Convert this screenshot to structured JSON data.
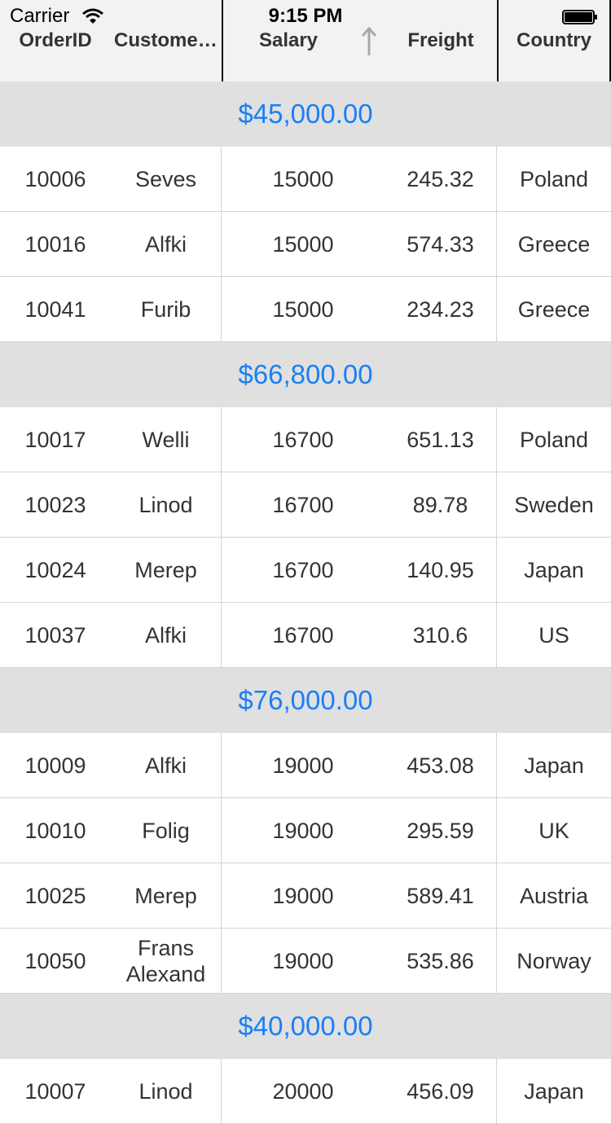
{
  "status_bar": {
    "carrier": "Carrier",
    "time": "9:15 PM"
  },
  "columns": [
    {
      "label": "OrderID"
    },
    {
      "label": "Customer..."
    },
    {
      "label": "Salary",
      "sort": "ascending"
    },
    {
      "label": "Freight"
    },
    {
      "label": "Country"
    }
  ],
  "groups": [
    {
      "caption": "$45,000.00",
      "rows": [
        [
          "10006",
          "Seves",
          "15000",
          "245.32",
          "Poland"
        ],
        [
          "10016",
          "Alfki",
          "15000",
          "574.33",
          "Greece"
        ],
        [
          "10041",
          "Furib",
          "15000",
          "234.23",
          "Greece"
        ]
      ]
    },
    {
      "caption": "$66,800.00",
      "rows": [
        [
          "10017",
          "Welli",
          "16700",
          "651.13",
          "Poland"
        ],
        [
          "10023",
          "Linod",
          "16700",
          "89.78",
          "Sweden"
        ],
        [
          "10024",
          "Merep",
          "16700",
          "140.95",
          "Japan"
        ],
        [
          "10037",
          "Alfki",
          "16700",
          "310.6",
          "US"
        ]
      ]
    },
    {
      "caption": "$76,000.00",
      "rows": [
        [
          "10009",
          "Alfki",
          "19000",
          "453.08",
          "Japan"
        ],
        [
          "10010",
          "Folig",
          "19000",
          "295.59",
          "UK"
        ],
        [
          "10025",
          "Merep",
          "19000",
          "589.41",
          "Austria"
        ],
        [
          "10050",
          "Frans Alexand",
          "19000",
          "535.86",
          "Norway"
        ]
      ]
    },
    {
      "caption": "$40,000.00",
      "rows": [
        [
          "10007",
          "Linod",
          "20000",
          "456.09",
          "Japan"
        ]
      ]
    }
  ]
}
